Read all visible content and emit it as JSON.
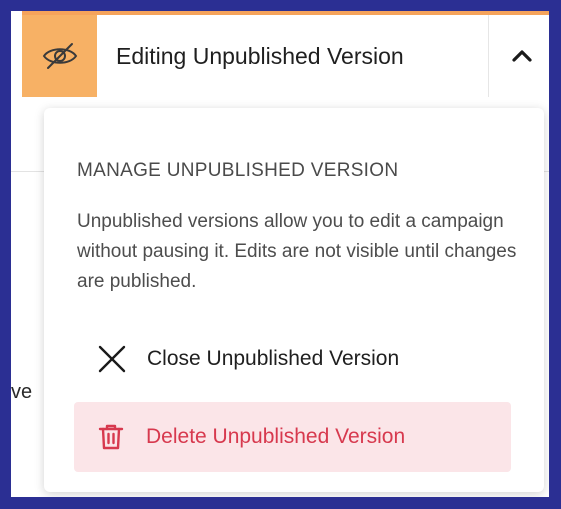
{
  "header": {
    "title": "Editing Unpublished Version"
  },
  "background": {
    "fragment": "ve"
  },
  "dropdown": {
    "heading": "MANAGE UNPUBLISHED VERSION",
    "description": "Unpublished versions allow you to edit a campaign without pausing it. Edits are not visible until changes are published.",
    "close_label": "Close Unpublished Version",
    "delete_label": "Delete Unpublished Version"
  },
  "icons": {
    "toggle": "eye-slash-icon",
    "chevron": "chevron-up-icon",
    "close": "close-x-icon",
    "delete": "trash-icon"
  },
  "colors": {
    "frame": "#2b2f93",
    "accent_orange": "#f7b165",
    "delete_text": "#d7394e",
    "delete_bg": "#fbe5e8"
  }
}
